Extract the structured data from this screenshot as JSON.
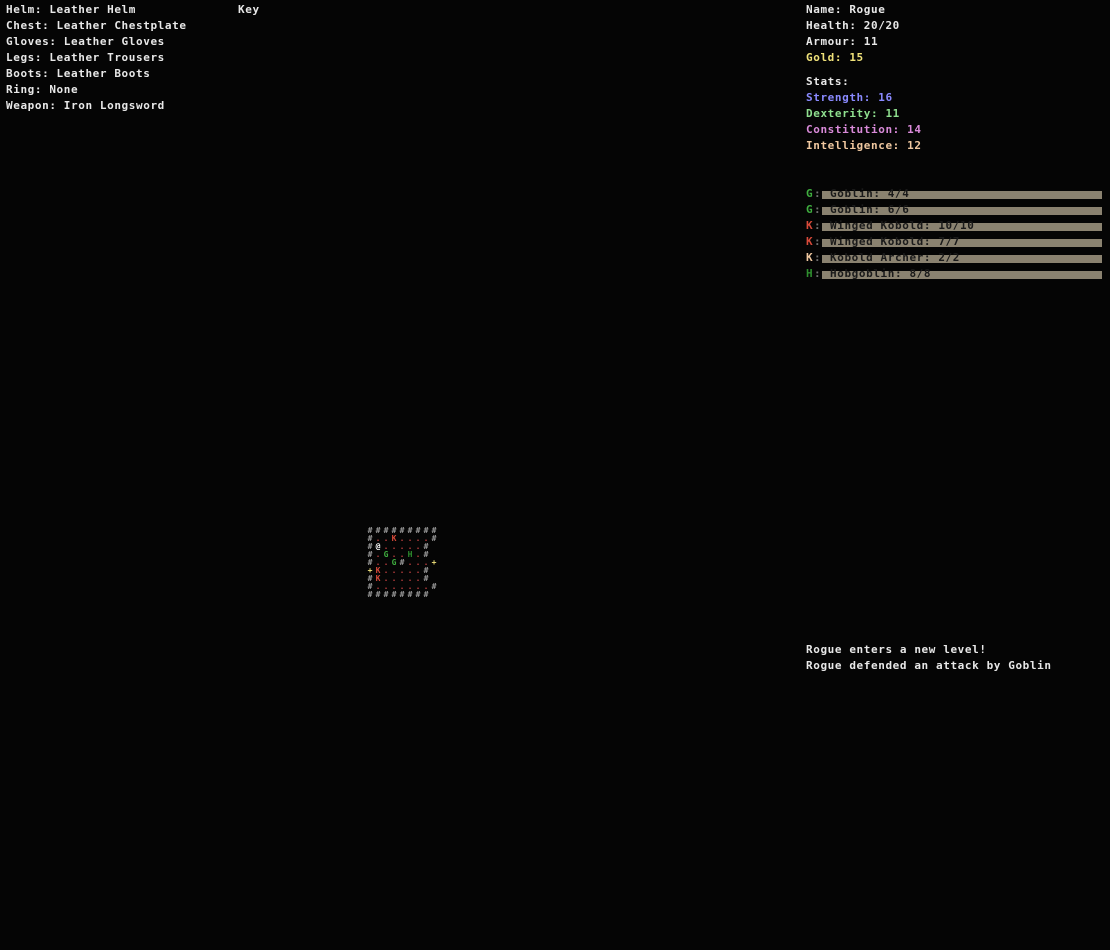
{
  "equipment": [
    {
      "label": "Helm: Leather Helm"
    },
    {
      "label": "Chest: Leather Chestplate"
    },
    {
      "label": "Gloves: Leather Gloves"
    },
    {
      "label": "Legs: Leather Trousers"
    },
    {
      "label": "Boots: Leather Boots"
    },
    {
      "label": "Ring: None"
    },
    {
      "label": "Weapon: Iron Longsword"
    }
  ],
  "key_label": "Key",
  "character": {
    "name": "Name: Rogue",
    "health": "Health: 20/20",
    "armour": "Armour: 11",
    "gold": "Gold: 15",
    "stats_header": "Stats:",
    "strength": "Strength: 16",
    "dexterity": "Dexterity: 11",
    "constitution": "Constitution: 14",
    "intelligence": "Intelligence: 12"
  },
  "colors": {
    "gold": "#f0e27a",
    "strength": "#8a8aff",
    "dexterity": "#8fdf8f",
    "constitution": "#d98ad9",
    "intelligence": "#f0c8a0",
    "goblin": "#3fae3f",
    "kobold": "#d84a3a",
    "archer": "#f0c8a0",
    "hobgoblin": "#2f8f2f",
    "bar": "#8a8270",
    "wall": "#9a9a9a",
    "floor": "#c04040",
    "player": "#ffffff"
  },
  "monsters": [
    {
      "glyph": "G",
      "colon": ":",
      "text": " Goblin: 4/4",
      "color": "#3fae3f",
      "hp_fraction": 1.0
    },
    {
      "glyph": "G",
      "colon": ":",
      "text": " Goblin: 6/6",
      "color": "#3fae3f",
      "hp_fraction": 1.0
    },
    {
      "glyph": "K",
      "colon": ":",
      "text": " Winged Kobold: 10/10",
      "color": "#d84a3a",
      "hp_fraction": 1.0
    },
    {
      "glyph": "K",
      "colon": ":",
      "text": " Winged Kobold: 7/7",
      "color": "#d84a3a",
      "hp_fraction": 1.0
    },
    {
      "glyph": "K",
      "colon": ":",
      "text": " Kobold Archer: 2/2",
      "color": "#f0c8a0",
      "hp_fraction": 1.0
    },
    {
      "glyph": "H",
      "colon": ":",
      "text": " Hobgoblin: 8/8",
      "color": "#2f8f2f",
      "hp_fraction": 1.0
    }
  ],
  "map": {
    "rows": [
      "#########",
      "#..K....#",
      "#@.....#",
      "#.G..H.#",
      "#..G#...+",
      "+K.....#",
      "#K.....#",
      "#.......#",
      "########"
    ]
  },
  "messages": [
    "Rogue enters a new level!",
    "Rogue defended an attack by Goblin"
  ]
}
